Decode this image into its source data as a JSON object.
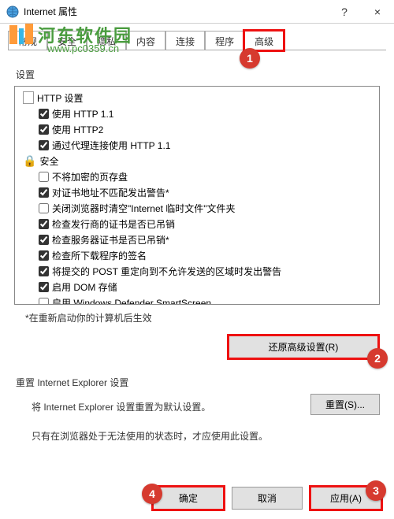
{
  "window": {
    "title": "Internet 属性",
    "help": "?",
    "close": "×"
  },
  "watermark": {
    "text": "河东软件园",
    "url": "www.pc0359.cn"
  },
  "tabs": {
    "items": [
      {
        "label": "常规"
      },
      {
        "label": "安全"
      },
      {
        "label": "隐私"
      },
      {
        "label": "内容"
      },
      {
        "label": "连接"
      },
      {
        "label": "程序"
      },
      {
        "label": "高级"
      }
    ]
  },
  "settings": {
    "label": "设置",
    "groups": [
      {
        "header": "HTTP 设置",
        "icon": "doc",
        "items": [
          {
            "label": "使用 HTTP 1.1",
            "checked": true
          },
          {
            "label": "使用 HTTP2",
            "checked": true
          },
          {
            "label": "通过代理连接使用 HTTP 1.1",
            "checked": true
          }
        ]
      },
      {
        "header": "安全",
        "icon": "lock",
        "items": [
          {
            "label": "不将加密的页存盘",
            "checked": false
          },
          {
            "label": "对证书地址不匹配发出警告*",
            "checked": true
          },
          {
            "label": "关闭浏览器时清空\"Internet 临时文件\"文件夹",
            "checked": false
          },
          {
            "label": "检查发行商的证书是否已吊销",
            "checked": true
          },
          {
            "label": "检查服务器证书是否已吊销*",
            "checked": true
          },
          {
            "label": "检查所下载程序的签名",
            "checked": true
          },
          {
            "label": "将提交的 POST 重定向到不允许发送的区域时发出警告",
            "checked": true
          },
          {
            "label": "启用 DOM 存储",
            "checked": true
          },
          {
            "label": "启用 Windows Defender SmartScreen",
            "checked": false
          }
        ]
      }
    ],
    "note": "*在重新启动你的计算机后生效",
    "restore_btn": "还原高级设置(R)"
  },
  "reset": {
    "group_label": "重置 Internet Explorer 设置",
    "desc": "将 Internet Explorer 设置重置为默认设置。",
    "btn": "重置(S)...",
    "footnote": "只有在浏览器处于无法使用的状态时，才应使用此设置。"
  },
  "buttons": {
    "ok": "确定",
    "cancel": "取消",
    "apply": "应用(A)"
  },
  "badges": {
    "b1": "1",
    "b2": "2",
    "b3": "3",
    "b4": "4"
  }
}
